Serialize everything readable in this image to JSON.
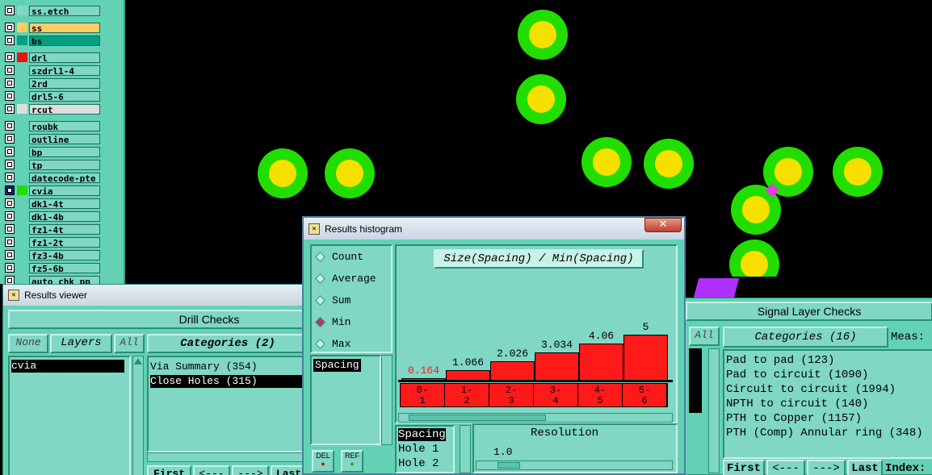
{
  "layers": [
    {
      "name": "ss.etch",
      "color": "#7fd7c4",
      "checked": false
    },
    {
      "name": "ss",
      "color": "#ffcc66",
      "checked": false
    },
    {
      "name": "bs",
      "color": "#00a080",
      "checked": false
    },
    {
      "name": "drl",
      "color": "#ee1111",
      "checked": false
    },
    {
      "name": "szdrl1-4",
      "color": "#63d1b4",
      "checked": false
    },
    {
      "name": "2rd",
      "color": "#63d1b4",
      "checked": false
    },
    {
      "name": "drl5-6",
      "color": "#63d1b4",
      "checked": false
    },
    {
      "name": "rcut",
      "color": "#dddddd",
      "checked": false
    },
    {
      "name": "roubk",
      "color": "#63d1b4",
      "checked": false
    },
    {
      "name": "outline",
      "color": "#63d1b4",
      "checked": false
    },
    {
      "name": "bp",
      "color": "#63d1b4",
      "checked": false
    },
    {
      "name": "tp",
      "color": "#63d1b4",
      "checked": false
    },
    {
      "name": "datecode-pte",
      "color": "#63d1b4",
      "checked": false
    },
    {
      "name": "cvia",
      "color": "#22dd00",
      "checked": true
    },
    {
      "name": "dk1-4t",
      "color": "#63d1b4",
      "checked": false
    },
    {
      "name": "dk1-4b",
      "color": "#63d1b4",
      "checked": false
    },
    {
      "name": "fz1-4t",
      "color": "#63d1b4",
      "checked": false
    },
    {
      "name": "fz1-2t",
      "color": "#63d1b4",
      "checked": false
    },
    {
      "name": "fz3-4b",
      "color": "#63d1b4",
      "checked": false
    },
    {
      "name": "fz5-6b",
      "color": "#63d1b4",
      "checked": false
    },
    {
      "name": "auto_chk_pp",
      "color": "#63d1b4",
      "checked": false
    }
  ],
  "colors": {
    "pad_ring": "#22dd00",
    "pad_center": "#f5e000",
    "panel": "#63d1b4",
    "bar": "#ff1a1a"
  },
  "viewer": {
    "title": "Results viewer",
    "header": "Drill Checks",
    "none_btn": "None",
    "layers_btn": "Layers",
    "all_btn": "All",
    "layer_list": [
      "cvia"
    ],
    "categories_header": "Categories (2)",
    "categories": [
      {
        "text": "Via Summary (354)",
        "selected": false
      },
      {
        "text": "Close Holes (315)",
        "selected": true
      }
    ],
    "nav": [
      "First",
      "<---",
      "--->",
      "Last"
    ]
  },
  "histogram": {
    "title": "Results histogram",
    "modes": [
      {
        "label": "Count",
        "on": false
      },
      {
        "label": "Average",
        "on": false
      },
      {
        "label": "Sum",
        "on": false
      },
      {
        "label": "Min",
        "on": true
      },
      {
        "label": "Max",
        "on": false
      }
    ],
    "attr_list": [
      "Spacing"
    ],
    "del_btn": "DEL",
    "ref_btn": "REF",
    "chart_title": "Size(Spacing) / Min(Spacing)",
    "measures": [
      "Spacing",
      "Hole 1",
      "Hole 2"
    ],
    "resolution_label": "Resolution",
    "resolution_value": "1.0",
    "resolution_fraction": 0.12
  },
  "chart_data": {
    "type": "bar",
    "title": "Size(Spacing) / Min(Spacing)",
    "categories": [
      "0-1",
      "1-2",
      "2-3",
      "3-4",
      "4-5",
      "5-6"
    ],
    "values": [
      0.164,
      1.066,
      2.026,
      3.034,
      4.06,
      5
    ],
    "labels": [
      "0.164",
      "1.066",
      "2.026",
      "3.034",
      "4.06",
      "5"
    ],
    "highlight_first": true,
    "ylim": [
      0,
      5
    ]
  },
  "signal": {
    "header": "Signal Layer Checks",
    "all_btn": "All",
    "categories_header": "Categories (16)",
    "meas_label": "Meas:",
    "items": [
      "Pad to pad (123)",
      "Pad to circuit (1090)",
      "Circuit to circuit (1994)",
      "NPTH to circuit (140)",
      "PTH to Copper (1157)",
      "PTH (Comp) Annular ring (348)"
    ],
    "nav": [
      "First",
      "<---",
      "--->",
      "Last",
      "Index:"
    ]
  }
}
